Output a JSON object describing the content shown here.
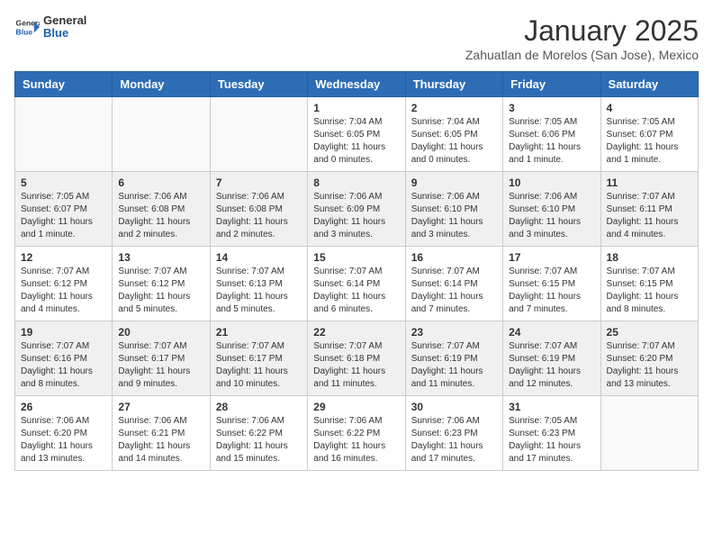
{
  "logo": {
    "text_general": "General",
    "text_blue": "Blue"
  },
  "title": "January 2025",
  "subtitle": "Zahuatlan de Morelos (San Jose), Mexico",
  "days_header": [
    "Sunday",
    "Monday",
    "Tuesday",
    "Wednesday",
    "Thursday",
    "Friday",
    "Saturday"
  ],
  "weeks": [
    [
      {
        "day": "",
        "info": ""
      },
      {
        "day": "",
        "info": ""
      },
      {
        "day": "",
        "info": ""
      },
      {
        "day": "1",
        "info": "Sunrise: 7:04 AM\nSunset: 6:05 PM\nDaylight: 11 hours\nand 0 minutes."
      },
      {
        "day": "2",
        "info": "Sunrise: 7:04 AM\nSunset: 6:05 PM\nDaylight: 11 hours\nand 0 minutes."
      },
      {
        "day": "3",
        "info": "Sunrise: 7:05 AM\nSunset: 6:06 PM\nDaylight: 11 hours\nand 1 minute."
      },
      {
        "day": "4",
        "info": "Sunrise: 7:05 AM\nSunset: 6:07 PM\nDaylight: 11 hours\nand 1 minute."
      }
    ],
    [
      {
        "day": "5",
        "info": "Sunrise: 7:05 AM\nSunset: 6:07 PM\nDaylight: 11 hours\nand 1 minute."
      },
      {
        "day": "6",
        "info": "Sunrise: 7:06 AM\nSunset: 6:08 PM\nDaylight: 11 hours\nand 2 minutes."
      },
      {
        "day": "7",
        "info": "Sunrise: 7:06 AM\nSunset: 6:08 PM\nDaylight: 11 hours\nand 2 minutes."
      },
      {
        "day": "8",
        "info": "Sunrise: 7:06 AM\nSunset: 6:09 PM\nDaylight: 11 hours\nand 3 minutes."
      },
      {
        "day": "9",
        "info": "Sunrise: 7:06 AM\nSunset: 6:10 PM\nDaylight: 11 hours\nand 3 minutes."
      },
      {
        "day": "10",
        "info": "Sunrise: 7:06 AM\nSunset: 6:10 PM\nDaylight: 11 hours\nand 3 minutes."
      },
      {
        "day": "11",
        "info": "Sunrise: 7:07 AM\nSunset: 6:11 PM\nDaylight: 11 hours\nand 4 minutes."
      }
    ],
    [
      {
        "day": "12",
        "info": "Sunrise: 7:07 AM\nSunset: 6:12 PM\nDaylight: 11 hours\nand 4 minutes."
      },
      {
        "day": "13",
        "info": "Sunrise: 7:07 AM\nSunset: 6:12 PM\nDaylight: 11 hours\nand 5 minutes."
      },
      {
        "day": "14",
        "info": "Sunrise: 7:07 AM\nSunset: 6:13 PM\nDaylight: 11 hours\nand 5 minutes."
      },
      {
        "day": "15",
        "info": "Sunrise: 7:07 AM\nSunset: 6:14 PM\nDaylight: 11 hours\nand 6 minutes."
      },
      {
        "day": "16",
        "info": "Sunrise: 7:07 AM\nSunset: 6:14 PM\nDaylight: 11 hours\nand 7 minutes."
      },
      {
        "day": "17",
        "info": "Sunrise: 7:07 AM\nSunset: 6:15 PM\nDaylight: 11 hours\nand 7 minutes."
      },
      {
        "day": "18",
        "info": "Sunrise: 7:07 AM\nSunset: 6:15 PM\nDaylight: 11 hours\nand 8 minutes."
      }
    ],
    [
      {
        "day": "19",
        "info": "Sunrise: 7:07 AM\nSunset: 6:16 PM\nDaylight: 11 hours\nand 8 minutes."
      },
      {
        "day": "20",
        "info": "Sunrise: 7:07 AM\nSunset: 6:17 PM\nDaylight: 11 hours\nand 9 minutes."
      },
      {
        "day": "21",
        "info": "Sunrise: 7:07 AM\nSunset: 6:17 PM\nDaylight: 11 hours\nand 10 minutes."
      },
      {
        "day": "22",
        "info": "Sunrise: 7:07 AM\nSunset: 6:18 PM\nDaylight: 11 hours\nand 11 minutes."
      },
      {
        "day": "23",
        "info": "Sunrise: 7:07 AM\nSunset: 6:19 PM\nDaylight: 11 hours\nand 11 minutes."
      },
      {
        "day": "24",
        "info": "Sunrise: 7:07 AM\nSunset: 6:19 PM\nDaylight: 11 hours\nand 12 minutes."
      },
      {
        "day": "25",
        "info": "Sunrise: 7:07 AM\nSunset: 6:20 PM\nDaylight: 11 hours\nand 13 minutes."
      }
    ],
    [
      {
        "day": "26",
        "info": "Sunrise: 7:06 AM\nSunset: 6:20 PM\nDaylight: 11 hours\nand 13 minutes."
      },
      {
        "day": "27",
        "info": "Sunrise: 7:06 AM\nSunset: 6:21 PM\nDaylight: 11 hours\nand 14 minutes."
      },
      {
        "day": "28",
        "info": "Sunrise: 7:06 AM\nSunset: 6:22 PM\nDaylight: 11 hours\nand 15 minutes."
      },
      {
        "day": "29",
        "info": "Sunrise: 7:06 AM\nSunset: 6:22 PM\nDaylight: 11 hours\nand 16 minutes."
      },
      {
        "day": "30",
        "info": "Sunrise: 7:06 AM\nSunset: 6:23 PM\nDaylight: 11 hours\nand 17 minutes."
      },
      {
        "day": "31",
        "info": "Sunrise: 7:05 AM\nSunset: 6:23 PM\nDaylight: 11 hours\nand 17 minutes."
      },
      {
        "day": "",
        "info": ""
      }
    ]
  ]
}
